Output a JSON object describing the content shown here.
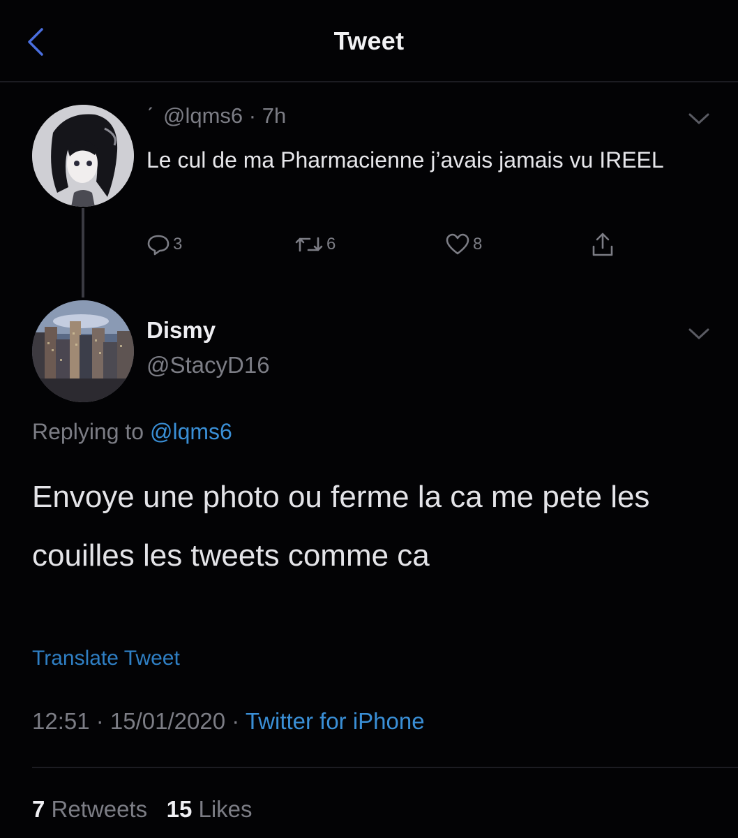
{
  "header": {
    "title": "Tweet"
  },
  "parent_tweet": {
    "handle_time": "@lqms6 · 7h",
    "text": "Le cul de ma Pharmacienne j’avais jamais vu IREEL",
    "reply_count": "3",
    "retweet_count": "6",
    "like_count": "8"
  },
  "main_tweet": {
    "display_name": "Dismy",
    "handle": "@StacyD16",
    "replying_prefix": "Replying to ",
    "replying_mention": "@lqms6",
    "text": "Envoye une photo ou ferme la ca me pete les couilles les tweets comme ca",
    "translate_label": "Translate Tweet",
    "timestamp": "12:51 · 15/01/2020 · ",
    "source": "Twitter for iPhone",
    "retweets_count": "7",
    "retweets_label": " Retweets",
    "likes_count": "15",
    "likes_label": " Likes"
  },
  "colors": {
    "background": "#030305",
    "text_primary": "#e6e6ea",
    "text_secondary": "#7c7d85",
    "link": "#3a8fd6",
    "accent_icon": "#4a6fe0"
  },
  "icons": {
    "back": "chevron-left-icon",
    "more": "chevron-down-icon",
    "reply": "comment-icon",
    "retweet": "retweet-icon",
    "like": "heart-icon",
    "share": "share-icon"
  }
}
